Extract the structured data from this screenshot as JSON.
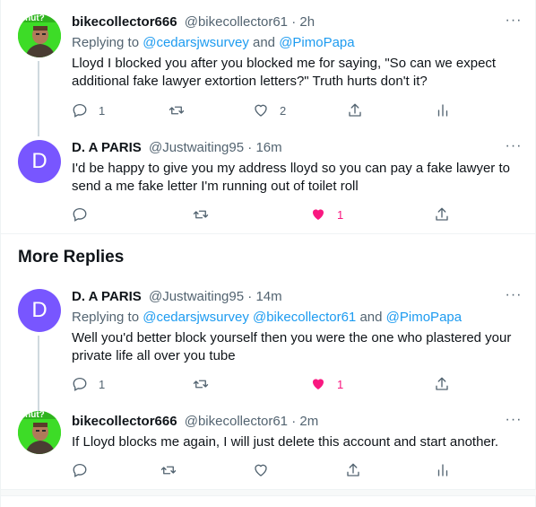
{
  "tweets": [
    {
      "name": "bikecollector666",
      "handle": "@bikecollector61",
      "time": "2h",
      "replying_prefix": "Replying to ",
      "replying_links": [
        "@cedarsjwsurvey",
        "@PimoPapa"
      ],
      "replying_and": " and ",
      "body": "Lloyd I blocked you after you blocked me for saying, \"So can we expect additional fake lawyer extortion letters?\"  Truth hurts don't it?",
      "reply_count": "1",
      "retweet_count": "",
      "like_count": "2",
      "avatar_caption": "uhut?"
    },
    {
      "name": "D. A PARIS",
      "handle": "@Justwaiting95",
      "time": "16m",
      "avatar_letter": "D",
      "body": "I'd be happy to give you my address lloyd so you can pay a fake lawyer to send a me fake letter I'm running out of toilet roll",
      "reply_count": "",
      "retweet_count": "",
      "like_count": "1"
    },
    {
      "name": "D. A PARIS",
      "handle": "@Justwaiting95",
      "time": "14m",
      "avatar_letter": "D",
      "replying_prefix": "Replying to ",
      "replying_links": [
        "@cedarsjwsurvey",
        "@bikecollector61",
        "@PimoPapa"
      ],
      "replying_and": " and ",
      "body": "Well you'd better block yourself then you were the one who plastered your private life all over you tube",
      "reply_count": "1",
      "retweet_count": "",
      "like_count": "1"
    },
    {
      "name": "bikecollector666",
      "handle": "@bikecollector61",
      "time": "2m",
      "body": "If Lloyd blocks me again, I will just delete this account and start another.",
      "reply_count": "",
      "retweet_count": "",
      "like_count": "",
      "avatar_caption": "uhut?"
    }
  ],
  "section": {
    "title": "More Replies"
  },
  "ui": {
    "dot": " · ",
    "more": "···"
  },
  "colors": {
    "accent": "#1d9bf0",
    "like": "#f91880",
    "muted": "#536471",
    "avatar_purple": "#7856ff",
    "avatar_green": "#3ddc27"
  },
  "icons": [
    "reply-icon",
    "retweet-icon",
    "like-icon",
    "liked-heart-icon",
    "share-icon",
    "analytics-icon",
    "more-icon"
  ]
}
